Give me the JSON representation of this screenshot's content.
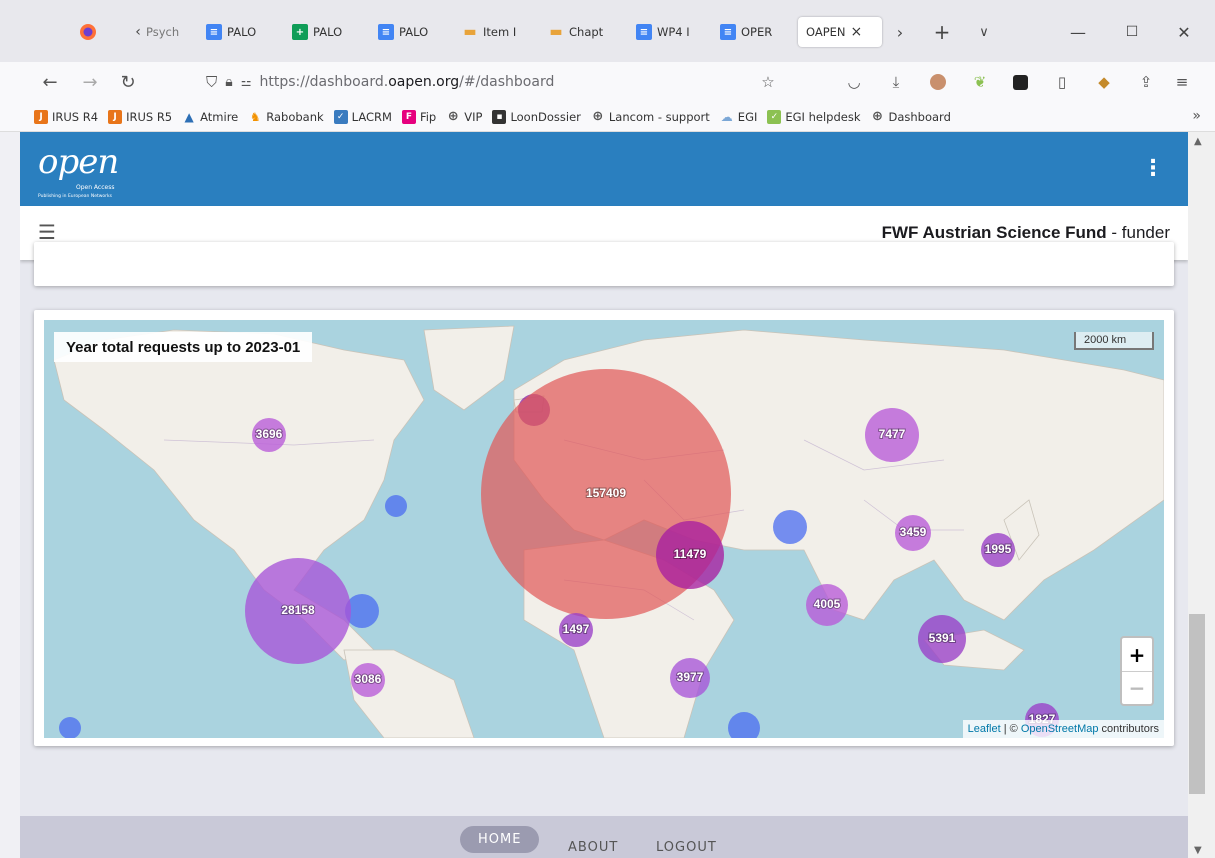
{
  "browser": {
    "tabs": [
      {
        "label": "Psych",
        "icon": "back-chevron"
      },
      {
        "label": "PALO",
        "icon": "doc-icon"
      },
      {
        "label": "PALO",
        "icon": "sheet-icon"
      },
      {
        "label": "PALO",
        "icon": "doc-icon"
      },
      {
        "label": "Item I",
        "icon": "dash-icon"
      },
      {
        "label": "Chapt",
        "icon": "dash-icon"
      },
      {
        "label": "WP4 I",
        "icon": "doc-icon"
      },
      {
        "label": "OPER",
        "icon": "doc-icon"
      },
      {
        "label": "OAPEN",
        "icon": "none",
        "active": true
      }
    ],
    "active_tab_close": "×",
    "url_prefix": "https://dashboard.",
    "url_domain": "oapen.org",
    "url_suffix": "/#/dashboard",
    "bookmarks": [
      {
        "label": "IRUS R4",
        "color": "#e8751a"
      },
      {
        "label": "IRUS R5",
        "color": "#e8751a"
      },
      {
        "label": "Atmire",
        "color": "#2d6fb5"
      },
      {
        "label": "Rabobank",
        "color": "#f39200"
      },
      {
        "label": "LACRM",
        "color": "#3a7bbf"
      },
      {
        "label": "Fip",
        "color": "#e6007e"
      },
      {
        "label": "VIP",
        "color": "#555555"
      },
      {
        "label": "LoonDossier",
        "color": "#333333"
      },
      {
        "label": "Lancom - support",
        "color": "#555555"
      },
      {
        "label": "EGI",
        "color": "#7ba7d6"
      },
      {
        "label": "EGI helpdesk",
        "color": "#8cc152"
      },
      {
        "label": "Dashboard",
        "color": "#555555"
      }
    ]
  },
  "app": {
    "logo_text": "open",
    "logo_sub1": "Open Access",
    "logo_sub2": "Publishing in European Networks",
    "org_name": "FWF Austrian Science Fund",
    "org_role": " - funder",
    "brand_color": "#2a7fbf"
  },
  "map": {
    "title": "Year total requests up to 2023-01",
    "scale_label": "2000 km",
    "zoom_in": "+",
    "zoom_out": "−",
    "attribution_leaflet": "Leaflet",
    "attribution_sep": " | © ",
    "attribution_osm": "OpenStreetMap",
    "attribution_tail": " contributors",
    "bubbles": [
      {
        "value": "157409",
        "color": "#e05a5a"
      },
      {
        "value": "28158",
        "color": "#a855d8"
      },
      {
        "value": "11479",
        "color": "#a81fa0"
      },
      {
        "value": "7477",
        "color": "#b85ad8"
      },
      {
        "value": "5391",
        "color": "#9a3fc8"
      },
      {
        "value": "4005",
        "color": "#b85ad8"
      },
      {
        "value": "3977",
        "color": "#a855d8"
      },
      {
        "value": "3696",
        "color": "#b85ad8"
      },
      {
        "value": "3459",
        "color": "#b85ad8"
      },
      {
        "value": "3086",
        "color": "#b85ad8"
      },
      {
        "value": "1995",
        "color": "#9a3fc8"
      },
      {
        "value": "1497",
        "color": "#9a3fc8"
      },
      {
        "value": "1827",
        "color": "#9a3fc8"
      }
    ]
  },
  "footer": {
    "home": "HOME",
    "about": "ABOUT",
    "logout": "LOGOUT"
  }
}
